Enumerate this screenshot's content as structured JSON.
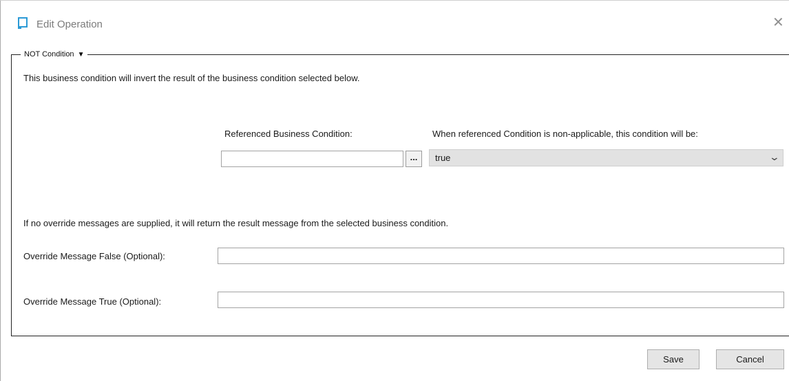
{
  "window": {
    "title": "Edit Operation",
    "close_glyph": "✕",
    "icon": "window-icon",
    "accent": "#2a9ad6"
  },
  "group": {
    "legend": "NOT Condition",
    "legend_glyph": "▼"
  },
  "description": "This business condition will invert the result of the business condition selected below.",
  "referenced": {
    "label": "Referenced Business Condition:",
    "value": "",
    "browse_label": "..."
  },
  "non_applicable": {
    "label": "When referenced Condition is non-applicable, this condition will be:",
    "selected": "true"
  },
  "override_note": "If no override messages are supplied, it will return the result message from the selected business condition.",
  "override_false": {
    "label": "Override Message False (Optional):",
    "value": ""
  },
  "override_true": {
    "label": "Override Message True (Optional):",
    "value": ""
  },
  "buttons": {
    "save": "Save",
    "cancel": "Cancel"
  }
}
